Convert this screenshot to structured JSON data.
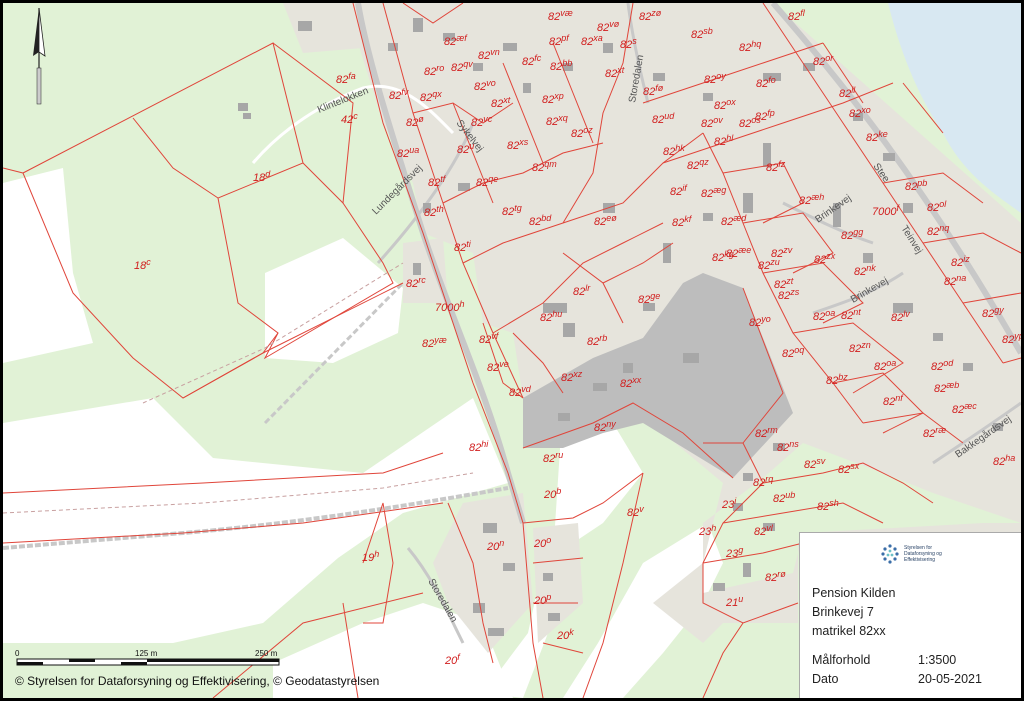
{
  "map": {
    "colors": {
      "forest": "#e1f2d6",
      "field": "#ffffff",
      "builtup": "#e6e4dc",
      "focus_area": "#bdbdbd",
      "water": "#d8e8f2",
      "parcel_line": "#e0453a",
      "road": "#c8c8c8"
    },
    "roads": [
      "Klintelokken",
      "Lundegårdsvej",
      "Sykelvej",
      "Storedalen",
      "Brinkevej",
      "Teinvej",
      "Bakkegårdsvej",
      "Storedalen"
    ],
    "parcels": [
      {
        "n": "82",
        "s": "fl"
      },
      {
        "n": "82",
        "s": "væ"
      },
      {
        "n": "82",
        "s": "zø"
      },
      {
        "n": "82",
        "s": "vø"
      },
      {
        "n": "82",
        "s": "xa"
      },
      {
        "n": "82",
        "s": "s"
      },
      {
        "n": "82",
        "s": "sb"
      },
      {
        "n": "82",
        "s": "æf"
      },
      {
        "n": "82",
        "s": "pf"
      },
      {
        "n": "82",
        "s": "vn"
      },
      {
        "n": "82",
        "s": "ro"
      },
      {
        "n": "82",
        "s": "qv"
      },
      {
        "n": "82",
        "s": "fc"
      },
      {
        "n": "82",
        "s": "bb"
      },
      {
        "n": "82",
        "s": "xt"
      },
      {
        "n": "82",
        "s": "hq"
      },
      {
        "n": "82",
        "s": "or"
      },
      {
        "n": "82",
        "s": "fa"
      },
      {
        "n": "82",
        "s": "fv"
      },
      {
        "n": "82",
        "s": "qx"
      },
      {
        "n": "82",
        "s": "vo"
      },
      {
        "n": "82",
        "s": "fø"
      },
      {
        "n": "82",
        "s": "oy"
      },
      {
        "n": "82",
        "s": "fo"
      },
      {
        "n": "82",
        "s": "xp"
      },
      {
        "n": "42",
        "s": "c"
      },
      {
        "n": "82",
        "s": "ø"
      },
      {
        "n": "82",
        "s": "vc"
      },
      {
        "n": "82",
        "s": "xt"
      },
      {
        "n": "82",
        "s": "xq"
      },
      {
        "n": "82",
        "s": "oz"
      },
      {
        "n": "82",
        "s": "ud"
      },
      {
        "n": "82",
        "s": "ox"
      },
      {
        "n": "82",
        "s": "ov"
      },
      {
        "n": "82",
        "s": "os"
      },
      {
        "n": "82",
        "s": "fp"
      },
      {
        "n": "82",
        "s": "ll"
      },
      {
        "n": "82",
        "s": "xo"
      },
      {
        "n": "82",
        "s": "xs"
      },
      {
        "n": "82",
        "s": "u"
      },
      {
        "n": "82",
        "s": "ua"
      },
      {
        "n": "82",
        "s": "hl"
      },
      {
        "n": "82",
        "s": "hk"
      },
      {
        "n": "82",
        "s": "qm"
      },
      {
        "n": "82",
        "s": "ke"
      },
      {
        "n": "18",
        "s": "d"
      },
      {
        "n": "82",
        "s": "tf"
      },
      {
        "n": "82",
        "s": "qe"
      },
      {
        "n": "82",
        "s": "qz"
      },
      {
        "n": "82",
        "s": "fz"
      },
      {
        "n": "82",
        "s": "pb"
      },
      {
        "n": "82",
        "s": "if"
      },
      {
        "n": "82",
        "s": "æg"
      },
      {
        "n": "82",
        "s": "æh"
      },
      {
        "n": "82",
        "s": "ol"
      },
      {
        "n": "82",
        "s": "th"
      },
      {
        "n": "82",
        "s": "tg"
      },
      {
        "n": "82",
        "s": "bd"
      },
      {
        "n": "82",
        "s": "eø"
      },
      {
        "n": "82",
        "s": "kf"
      },
      {
        "n": "82",
        "s": "æd"
      },
      {
        "n": "7000",
        "s": "f"
      },
      {
        "n": "82",
        "s": "nq"
      },
      {
        "n": "82",
        "s": "gg"
      },
      {
        "n": "82",
        "s": "ti"
      },
      {
        "n": "82",
        "s": "æe"
      },
      {
        "n": "82",
        "s": "zv"
      },
      {
        "n": "82",
        "s": "zx"
      },
      {
        "n": "82",
        "s": "kg"
      },
      {
        "n": "82",
        "s": "zu"
      },
      {
        "n": "82",
        "s": "nk"
      },
      {
        "n": "82",
        "s": "iz"
      },
      {
        "n": "18",
        "s": "c"
      },
      {
        "n": "82",
        "s": "zt"
      },
      {
        "n": "82",
        "s": "na"
      },
      {
        "n": "82",
        "s": "rc"
      },
      {
        "n": "82",
        "s": "lr"
      },
      {
        "n": "82",
        "s": "ge"
      },
      {
        "n": "82",
        "s": "zs"
      },
      {
        "n": "7000",
        "s": "h"
      },
      {
        "n": "82",
        "s": "hu"
      },
      {
        "n": "82",
        "s": "yo"
      },
      {
        "n": "82",
        "s": "oa"
      },
      {
        "n": "82",
        "s": "nt"
      },
      {
        "n": "82",
        "s": "lv"
      },
      {
        "n": "82",
        "s": "gy"
      },
      {
        "n": "82",
        "s": "vf"
      },
      {
        "n": "82",
        "s": "rb"
      },
      {
        "n": "82",
        "s": "zn"
      },
      {
        "n": "82",
        "s": "yp"
      },
      {
        "n": "82",
        "s": "yæ"
      },
      {
        "n": "82",
        "s": "oq"
      },
      {
        "n": "82",
        "s": "ve"
      },
      {
        "n": "82",
        "s": "xz"
      },
      {
        "n": "82",
        "s": "xx"
      },
      {
        "n": "82",
        "s": "bz"
      },
      {
        "n": "82",
        "s": "oa"
      },
      {
        "n": "82",
        "s": "od"
      },
      {
        "n": "82",
        "s": "vd"
      },
      {
        "n": "82",
        "s": "æb"
      },
      {
        "n": "82",
        "s": "nf"
      },
      {
        "n": "82",
        "s": "æc"
      },
      {
        "n": "82",
        "s": "ny"
      },
      {
        "n": "82",
        "s": "rm"
      },
      {
        "n": "82",
        "s": "ræ"
      },
      {
        "n": "82",
        "s": "hi"
      },
      {
        "n": "82",
        "s": "ns"
      },
      {
        "n": "82",
        "s": "ru"
      },
      {
        "n": "82",
        "s": "sv"
      },
      {
        "n": "82",
        "s": "sx"
      },
      {
        "n": "82",
        "s": "ha"
      },
      {
        "n": "82",
        "s": "rq"
      },
      {
        "n": "20",
        "s": "b"
      },
      {
        "n": "82",
        "s": "ub"
      },
      {
        "n": "23",
        "s": "i"
      },
      {
        "n": "82",
        "s": "sh"
      },
      {
        "n": "82",
        "s": "v"
      },
      {
        "n": "23",
        "s": "h"
      },
      {
        "n": "82",
        "s": "vl"
      },
      {
        "n": "20",
        "s": "n"
      },
      {
        "n": "20",
        "s": "o"
      },
      {
        "n": "23",
        "s": "g"
      },
      {
        "n": "19",
        "s": "h"
      },
      {
        "n": "82",
        "s": "rø"
      },
      {
        "n": "20",
        "s": "p"
      },
      {
        "n": "21",
        "s": "u"
      },
      {
        "n": "20",
        "s": "k"
      },
      {
        "n": "20",
        "s": "f"
      }
    ]
  },
  "scalebar": {
    "labels": [
      "0",
      "125 m",
      "250 m"
    ]
  },
  "infobox": {
    "logo_text": [
      "Styrelsen for",
      "Dataforsyning og",
      "Effektivisering"
    ],
    "title": "Pension Kilden",
    "address": "Brinkevej 7",
    "matrikel": "matrikel 82xx",
    "scale_label": "Målforhold",
    "scale_value": "1:3500",
    "date_label": "Dato",
    "date_value": "20-05-2021"
  },
  "copyright": "© Styrelsen for Dataforsyning og Effektivisering, © Geodatastyrelsen"
}
